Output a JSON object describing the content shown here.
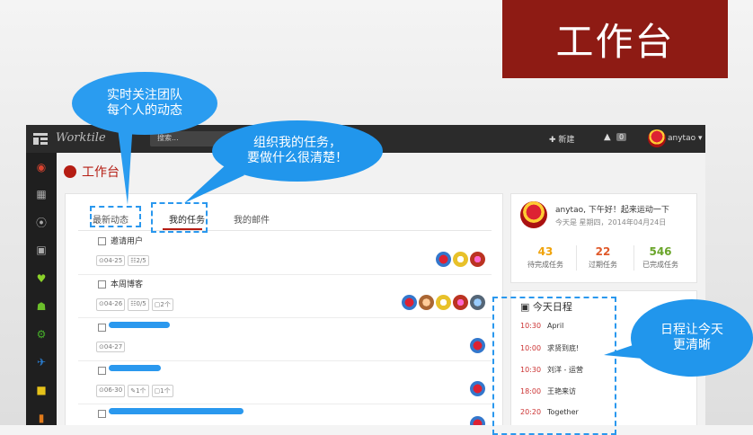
{
  "banner": {
    "title": "工作台"
  },
  "topbar": {
    "app_name": "Worktile",
    "search_placeholder": "搜索...",
    "new_label": "✚ 新建",
    "bell": "bell-icon",
    "notif_count": "0",
    "username": "anytao ▾"
  },
  "page": {
    "title": "工作台"
  },
  "tabs": [
    {
      "label": "最新动态"
    },
    {
      "label": "我的任务"
    },
    {
      "label": "我的邮件"
    }
  ],
  "tasks": [
    {
      "name": "邀请用户",
      "date": "⊙04-25",
      "sub": "☷2/5",
      "comments": "",
      "attach": ""
    },
    {
      "name": "本周博客",
      "date": "⊙04-26",
      "sub": "☷0/5",
      "comments": "▢2个",
      "attach": ""
    },
    {
      "name": "",
      "date": "⊙04-27",
      "sub": "",
      "comments": "",
      "attach": ""
    },
    {
      "name": "",
      "date": "⊙06-30",
      "sub": "",
      "comments": "▢1个",
      "attach": "✎1个"
    },
    {
      "name": "",
      "date": "",
      "sub": "",
      "comments": "",
      "attach": ""
    }
  ],
  "profile": {
    "greeting": "anytao, 下午好！起来运动一下",
    "date": "今天是 星期四，2014年04月24日",
    "stats": [
      {
        "value": "43",
        "label": "待完成任务",
        "color": "#f0a30a"
      },
      {
        "value": "22",
        "label": "过期任务",
        "color": "#e05a2b"
      },
      {
        "value": "546",
        "label": "已完成任务",
        "color": "#6aa52a"
      }
    ]
  },
  "schedule": {
    "title": "今天日程",
    "events": [
      {
        "time": "10:30",
        "event": "April"
      },
      {
        "time": "10:00",
        "event": "求贤到底!"
      },
      {
        "time": "10:30",
        "event": "刘洋 - 运营"
      },
      {
        "time": "18:00",
        "event": "王艳来访"
      },
      {
        "time": "20:20",
        "event": "Together"
      }
    ]
  },
  "callouts": {
    "team": [
      "实时关注团队",
      "每个人的动态"
    ],
    "tasks": [
      "组织我的任务，",
      "要做什么很清楚！"
    ],
    "schedule": [
      "日程让今天",
      "更清晰"
    ]
  }
}
